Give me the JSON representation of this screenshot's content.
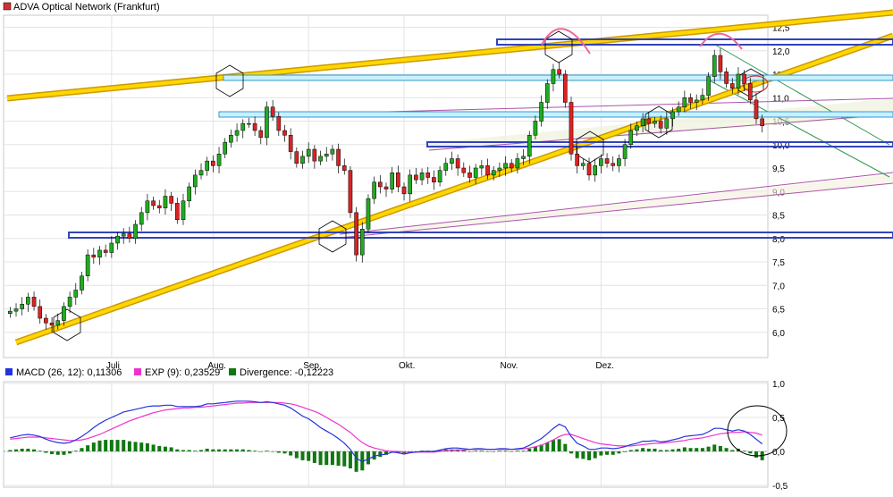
{
  "chart_data": [
    {
      "type": "candlestick",
      "title": "ADVA Optical Network (Frankfurt)",
      "title_marker_color": "#d03030",
      "y_ticks": [
        6.0,
        6.5,
        7.0,
        7.5,
        8.0,
        8.5,
        9.0,
        9.5,
        10.0,
        10.5,
        11.0,
        11.5,
        12.0,
        12.5
      ],
      "y_tick_labels": [
        "6,0",
        "6,5",
        "7,0",
        "7,5",
        "8,0",
        "8,5",
        "9,0",
        "9,5",
        "10,0",
        "10,5",
        "11,0",
        "11,5",
        "12,0",
        "12,5"
      ],
      "ylim": [
        5.5,
        12.7
      ],
      "x_tick_labels": [
        "Juli",
        "Aug.",
        "Sep.",
        "Okt.",
        "Nov.",
        "Dez."
      ],
      "x_tick_index": [
        17,
        34,
        50,
        66,
        83,
        99
      ],
      "grid": true,
      "up_color": "#22aa22",
      "down_color": "#dd2222",
      "closes": [
        6.45,
        6.5,
        6.6,
        6.75,
        6.55,
        6.3,
        6.2,
        6.15,
        6.25,
        6.55,
        6.75,
        6.9,
        7.2,
        7.65,
        7.6,
        7.75,
        7.7,
        7.9,
        8.05,
        8.1,
        8.0,
        8.3,
        8.55,
        8.8,
        8.7,
        8.65,
        8.9,
        8.75,
        8.4,
        8.8,
        9.1,
        9.35,
        9.45,
        9.65,
        9.55,
        9.8,
        10.05,
        10.2,
        10.3,
        10.45,
        10.45,
        10.3,
        10.15,
        10.8,
        10.6,
        10.3,
        10.2,
        9.85,
        9.6,
        9.75,
        9.9,
        9.65,
        9.75,
        9.8,
        9.9,
        9.55,
        9.45,
        8.55,
        7.65,
        8.2,
        8.85,
        9.2,
        9.1,
        9.05,
        9.4,
        9.1,
        8.95,
        9.35,
        9.25,
        9.4,
        9.3,
        9.2,
        9.45,
        9.6,
        9.7,
        9.5,
        9.4,
        9.3,
        9.5,
        9.55,
        9.35,
        9.45,
        9.5,
        9.6,
        9.5,
        9.7,
        9.75,
        10.2,
        10.5,
        10.9,
        11.3,
        11.6,
        11.5,
        10.9,
        9.8,
        9.55,
        9.6,
        9.35,
        9.55,
        9.7,
        9.6,
        9.55,
        9.7,
        10.0,
        10.3,
        10.4,
        10.55,
        10.45,
        10.5,
        10.35,
        10.55,
        10.7,
        10.8,
        11.0,
        10.9,
        10.95,
        11.05,
        11.45,
        11.9,
        11.55,
        11.3,
        11.2,
        11.5,
        11.3,
        10.95,
        10.55,
        10.4
      ],
      "macd_label": "MACD (26, 12): 0,11306",
      "exp_label": "EXP (9): 0,23529",
      "divergence_label": "Divergence: -0,12223",
      "macd_color": "#2233dd",
      "exp_color": "#ee33cc",
      "divergence_color": "#117711",
      "macd_y_ticks": [
        -0.5,
        0.0,
        0.5,
        1.0
      ],
      "macd_y_tick_labels": [
        "-0,5",
        "0,0",
        "0,5",
        "1,0"
      ],
      "macd_ylim": [
        -0.5,
        1.0
      ],
      "macd": [
        0.2,
        0.22,
        0.24,
        0.25,
        0.24,
        0.22,
        0.18,
        0.15,
        0.13,
        0.12,
        0.13,
        0.17,
        0.22,
        0.28,
        0.35,
        0.41,
        0.46,
        0.5,
        0.54,
        0.58,
        0.6,
        0.62,
        0.64,
        0.66,
        0.67,
        0.67,
        0.68,
        0.68,
        0.66,
        0.66,
        0.66,
        0.66,
        0.67,
        0.7,
        0.7,
        0.71,
        0.72,
        0.73,
        0.74,
        0.74,
        0.74,
        0.73,
        0.72,
        0.73,
        0.72,
        0.7,
        0.68,
        0.64,
        0.58,
        0.52,
        0.48,
        0.42,
        0.35,
        0.3,
        0.25,
        0.19,
        0.12,
        0.03,
        -0.1,
        -0.15,
        -0.11,
        -0.07,
        -0.05,
        -0.04,
        -0.01,
        -0.02,
        -0.04,
        -0.02,
        -0.01,
        0.0,
        0.0,
        0.0,
        0.02,
        0.04,
        0.05,
        0.05,
        0.04,
        0.03,
        0.04,
        0.04,
        0.03,
        0.03,
        0.04,
        0.04,
        0.03,
        0.04,
        0.05,
        0.09,
        0.14,
        0.19,
        0.26,
        0.34,
        0.4,
        0.36,
        0.22,
        0.12,
        0.08,
        0.03,
        0.03,
        0.05,
        0.05,
        0.04,
        0.05,
        0.07,
        0.1,
        0.12,
        0.15,
        0.15,
        0.16,
        0.14,
        0.15,
        0.17,
        0.19,
        0.22,
        0.23,
        0.24,
        0.25,
        0.29,
        0.34,
        0.34,
        0.32,
        0.3,
        0.32,
        0.3,
        0.25,
        0.18,
        0.11
      ],
      "exp": [
        0.18,
        0.19,
        0.2,
        0.21,
        0.21,
        0.21,
        0.2,
        0.19,
        0.18,
        0.17,
        0.16,
        0.16,
        0.17,
        0.19,
        0.22,
        0.25,
        0.29,
        0.33,
        0.37,
        0.41,
        0.45,
        0.48,
        0.51,
        0.54,
        0.57,
        0.59,
        0.61,
        0.62,
        0.63,
        0.64,
        0.64,
        0.65,
        0.65,
        0.66,
        0.67,
        0.68,
        0.69,
        0.7,
        0.71,
        0.71,
        0.72,
        0.72,
        0.72,
        0.72,
        0.72,
        0.72,
        0.71,
        0.7,
        0.68,
        0.65,
        0.62,
        0.59,
        0.55,
        0.5,
        0.45,
        0.4,
        0.34,
        0.28,
        0.2,
        0.13,
        0.08,
        0.05,
        0.03,
        0.01,
        0.0,
        0.0,
        -0.01,
        -0.01,
        -0.01,
        -0.01,
        -0.01,
        -0.01,
        0.0,
        0.01,
        0.02,
        0.02,
        0.02,
        0.03,
        0.03,
        0.03,
        0.03,
        0.03,
        0.03,
        0.03,
        0.03,
        0.03,
        0.04,
        0.05,
        0.07,
        0.09,
        0.13,
        0.17,
        0.22,
        0.25,
        0.25,
        0.22,
        0.19,
        0.16,
        0.13,
        0.11,
        0.1,
        0.09,
        0.08,
        0.08,
        0.08,
        0.09,
        0.1,
        0.11,
        0.12,
        0.12,
        0.13,
        0.14,
        0.15,
        0.16,
        0.18,
        0.19,
        0.2,
        0.22,
        0.24,
        0.26,
        0.27,
        0.28,
        0.28,
        0.29,
        0.28,
        0.27,
        0.24
      ]
    }
  ]
}
